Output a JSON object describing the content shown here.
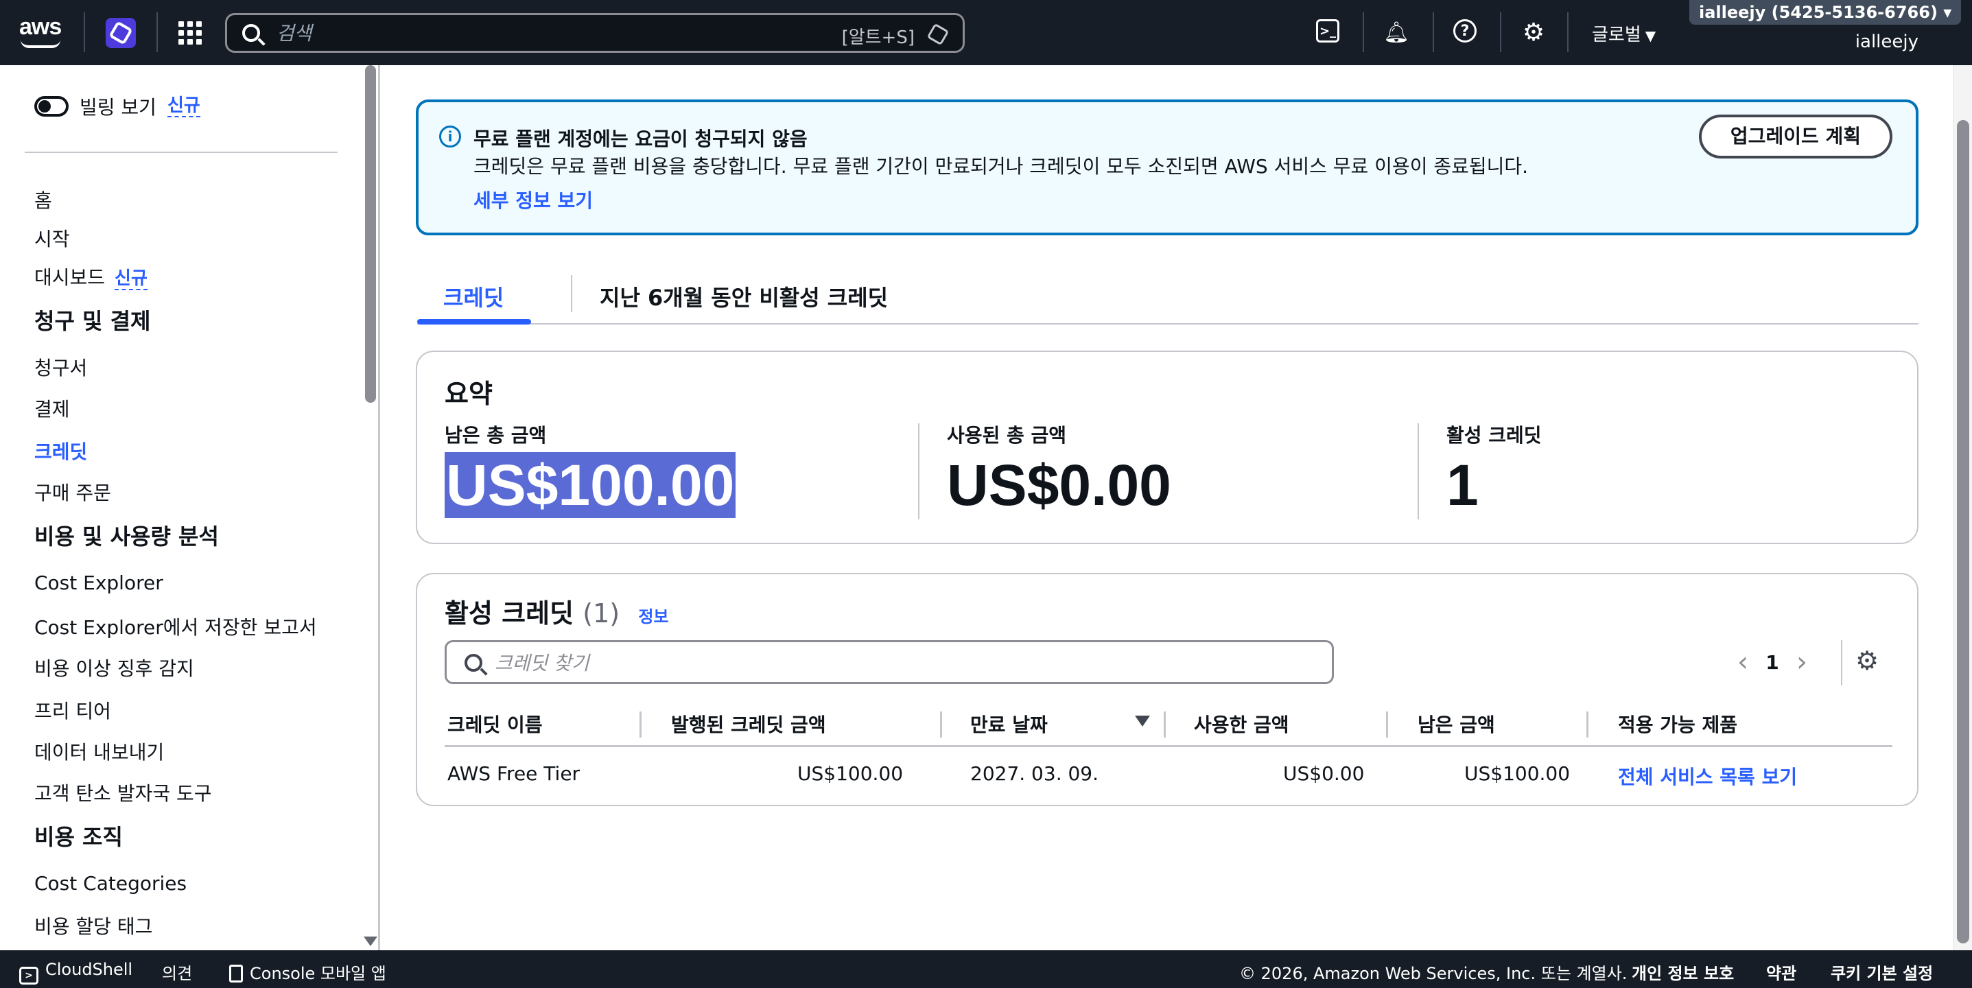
{
  "topnav": {
    "logo_text": "aws",
    "search_placeholder": "검색",
    "search_shortcut": "[알트+S]",
    "region_label": "글로벌",
    "account_badge": "ialleejy (5425-5136-6766) ▾",
    "account_user": "ialleejy"
  },
  "sidebar": {
    "billing_view_label": "빌링 보기",
    "new_badge": "신규",
    "items": [
      {
        "label": "홈"
      },
      {
        "label": "시작"
      },
      {
        "label": "대시보드"
      }
    ],
    "section_billing": "청구 및 결제",
    "billing_items": [
      {
        "label": "청구서"
      },
      {
        "label": "결제"
      },
      {
        "label": "크레딧"
      },
      {
        "label": "구매 주문"
      }
    ],
    "section_cost": "비용 및 사용량 분석",
    "cost_items": [
      {
        "label": "Cost Explorer"
      },
      {
        "label": "Cost Explorer에서 저장한 보고서"
      },
      {
        "label": "비용 이상 징후 감지"
      },
      {
        "label": "프리 티어"
      },
      {
        "label": "데이터 내보내기"
      },
      {
        "label": "고객 탄소 발자국 도구"
      }
    ],
    "section_org": "비용 조직",
    "org_items": [
      {
        "label": "Cost Categories"
      },
      {
        "label": "비용 할당 태그"
      }
    ]
  },
  "alert": {
    "title": "무료 플랜 계정에는 요금이 청구되지 않음",
    "body": "크레딧은 무료 플랜 비용을 충당합니다. 무료 플랜 기간이 만료되거나 크레딧이 모두 소진되면 AWS 서비스 무료 이용이 종료됩니다.",
    "link": "세부 정보 보기",
    "upgrade_button": "업그레이드 계획"
  },
  "tabs": [
    {
      "label": "크레딧"
    },
    {
      "label": "지난 6개월 동안 비활성 크레딧"
    }
  ],
  "summary": {
    "title": "요약",
    "remaining_label": "남은 총 금액",
    "remaining_value": "US$100.00",
    "used_label": "사용된 총 금액",
    "used_value": "US$0.00",
    "active_label": "활성 크레딧",
    "active_value": "1"
  },
  "credits": {
    "title": "활성 크레딧",
    "count": "(1)",
    "info_link": "정보",
    "filter_placeholder": "크레딧 찾기",
    "page_number": "1",
    "columns": [
      "크레딧 이름",
      "발행된 크레딧 금액",
      "만료 날짜",
      "사용한 금액",
      "남은 금액",
      "적용 가능 제품"
    ],
    "rows": [
      {
        "name": "AWS Free Tier",
        "issued": "US$100.00",
        "expires": "2027. 03. 09.",
        "used": "US$0.00",
        "remaining": "US$100.00",
        "products": "전체 서비스 목록 보기"
      }
    ]
  },
  "footer": {
    "cloudshell": "CloudShell",
    "feedback": "의견",
    "mobile_app": "Console 모바일 앱",
    "copyright": "© 2026, Amazon Web Services, Inc. 또는 계열사.",
    "privacy": "개인 정보 보호",
    "terms": "약관",
    "cookies": "쿠키 기본 설정"
  },
  "colors": {
    "nav_bg": "#161d26",
    "link_blue": "#295eff",
    "info_border": "#0073bb",
    "info_bg": "#f0fbff",
    "selection": "#5a6bd6"
  }
}
